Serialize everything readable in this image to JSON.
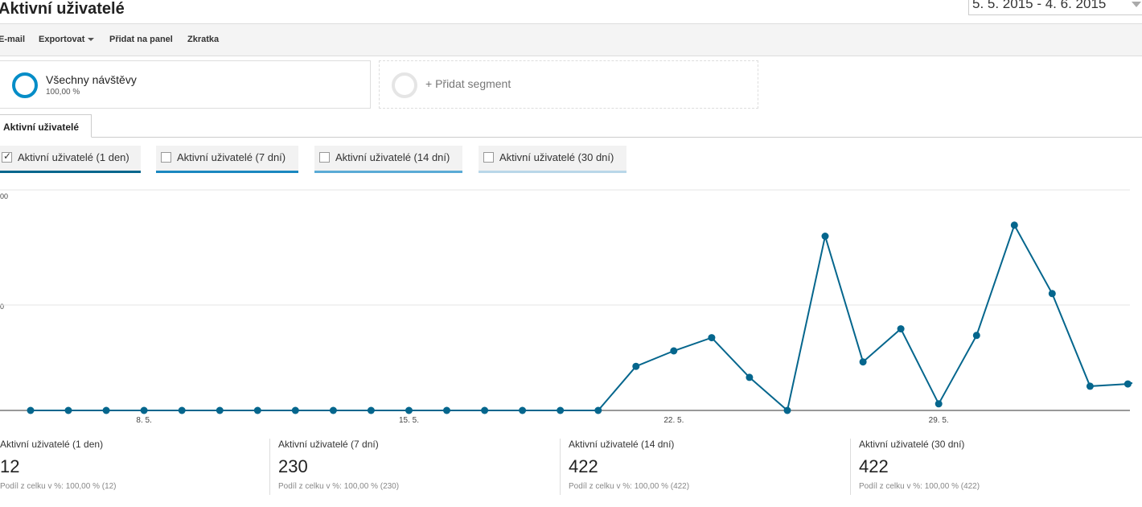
{
  "header": {
    "title": "Aktivní uživatelé",
    "date_range": "5. 5. 2015 - 4. 6. 2015"
  },
  "toolbar": {
    "email": "E-mail",
    "export": "Exportovat",
    "add_to_dashboard": "Přidat na panel",
    "shortcut": "Zkratka"
  },
  "segments": {
    "all_visits": {
      "name": "Všechny návštěvy",
      "pct": "100,00 %"
    },
    "add_segment": "+ Přidat segment"
  },
  "tab": {
    "label": "Aktivní uživatelé"
  },
  "metric_toggles": [
    {
      "label": "Aktivní uživatelé (1 den)",
      "checked": true,
      "color": "#05668d"
    },
    {
      "label": "Aktivní uživatelé (7 dní)",
      "checked": false,
      "color": "#1a87c0"
    },
    {
      "label": "Aktivní uživatelé (14 dní)",
      "checked": false,
      "color": "#5aabd6"
    },
    {
      "label": "Aktivní uživatelé (30 dní)",
      "checked": false,
      "color": "#b9d7e9"
    }
  ],
  "chart_data": {
    "type": "line",
    "series": [
      {
        "name": "Aktivní uživatelé (1 den)",
        "color": "#05668d"
      }
    ],
    "x": [
      "5. 5.",
      "6. 5.",
      "7. 5.",
      "8. 5.",
      "9. 5.",
      "10. 5.",
      "11. 5.",
      "12. 5.",
      "13. 5.",
      "14. 5.",
      "15. 5.",
      "16. 5.",
      "17. 5.",
      "18. 5.",
      "19. 5.",
      "20. 5.",
      "21. 5.",
      "22. 5.",
      "23. 5.",
      "24. 5.",
      "25. 5.",
      "26. 5.",
      "27. 5.",
      "28. 5.",
      "29. 5.",
      "30. 5.",
      "31. 5.",
      "1. 6.",
      "2. 6.",
      "3. 6.",
      "4. 6."
    ],
    "x_tick_labels": [
      "8. 5.",
      "15. 5.",
      "22. 5.",
      "29. 5."
    ],
    "y_tick_labels": [
      "00",
      "0"
    ],
    "values": [
      0,
      0,
      0,
      0,
      0,
      0,
      0,
      0,
      0,
      0,
      0,
      0,
      0,
      0,
      0,
      0,
      2,
      2.7,
      3.3,
      1.5,
      0,
      7.9,
      2.2,
      3.7,
      0.3,
      3.4,
      8.4,
      5.3,
      1.1,
      1.2
    ],
    "ylim": [
      0,
      10
    ],
    "grid": true
  },
  "summary": [
    {
      "label": "Aktivní uživatelé (1 den)",
      "value": "12",
      "sub": "Podíl z celku v %: 100,00 % (12)"
    },
    {
      "label": "Aktivní uživatelé (7 dní)",
      "value": "230",
      "sub": "Podíl z celku v %: 100,00 % (230)"
    },
    {
      "label": "Aktivní uživatelé (14 dní)",
      "value": "422",
      "sub": "Podíl z celku v %: 100,00 % (422)"
    },
    {
      "label": "Aktivní uživatelé (30 dní)",
      "value": "422",
      "sub": "Podíl z celku v %: 100,00 % (422)"
    }
  ]
}
